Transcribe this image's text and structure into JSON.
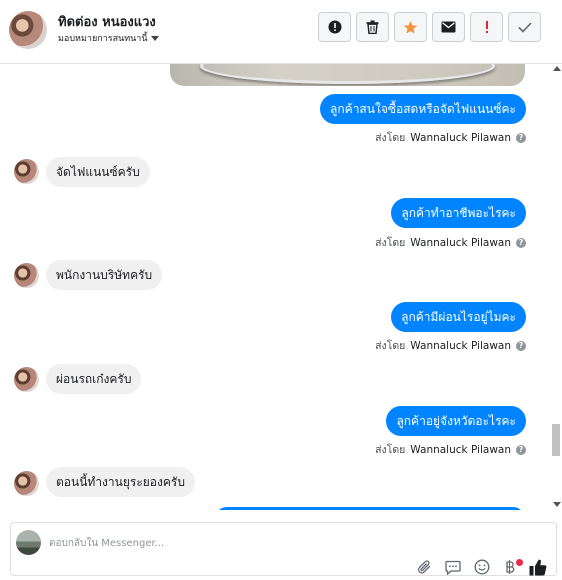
{
  "header": {
    "name": "ทิดต่อง หนองแวง",
    "assign_label": "มอบหมายการสนทนานี้",
    "actions": [
      {
        "name": "report-icon",
        "glyph": "!"
      },
      {
        "name": "trash-icon",
        "glyph": "🗑"
      },
      {
        "name": "star-icon",
        "glyph": "★"
      },
      {
        "name": "mail-icon",
        "glyph": "✉"
      },
      {
        "name": "exclamation-icon",
        "glyph": "!"
      },
      {
        "name": "check-icon",
        "glyph": "✓"
      }
    ]
  },
  "conversation": {
    "sender_prefix": "ส่งโดย",
    "sender_name": "Wannaluck Pilawan",
    "messages": [
      {
        "dir": "out",
        "text": "ลูกค้าสนใจซื้อสดหรือจัดไฟแนนซ์คะ"
      },
      {
        "dir": "in",
        "text": "จัดไฟแนนซ์ครับ"
      },
      {
        "dir": "out",
        "text": "ลูกค้าทำอาชีพอะไรคะ"
      },
      {
        "dir": "in",
        "text": "พนักงานบริษัทครับ"
      },
      {
        "dir": "out",
        "text": "ลูกค้ามีผ่อนไรอยู่ไมคะ"
      },
      {
        "dir": "in",
        "text": "ผ่อนรถเก๋งครับ"
      },
      {
        "dir": "out",
        "text": "ลูกค้าอยู่จังหวัดอะไรคะ"
      },
      {
        "dir": "in",
        "text": "ตอนนี้ทำงานยุระยองครับ"
      }
    ]
  },
  "composer": {
    "placeholder": "ตอบกลับใน Messenger...",
    "icons": [
      "paperclip-icon",
      "chat-bubble-icon",
      "emoji-icon",
      "baht-icon",
      "thumbs-up-icon"
    ]
  },
  "colors": {
    "accent": "#0084ff",
    "incoming_bg": "#f1f0f0",
    "star": "#f7923b",
    "alert": "#e4262c"
  }
}
